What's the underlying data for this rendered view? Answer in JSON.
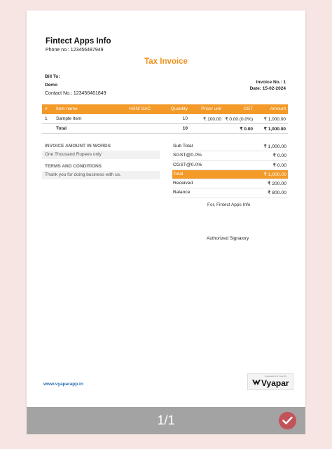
{
  "company": {
    "name": "Fintect Apps Info",
    "phone": "Phone no.: 123456487949"
  },
  "document": {
    "title": "Tax Invoice"
  },
  "bill_to": {
    "label": "Bill To:",
    "name": "Demo",
    "contact": "Contact No.: 123456461849"
  },
  "invoice_meta": {
    "number": "Invoice No.: 1",
    "date": "Date: 15-02-2024"
  },
  "items_table": {
    "headers": [
      "#",
      "Item name",
      "HSN/ SAC",
      "Quantity",
      "Price/ unit",
      "GST",
      "Amount"
    ],
    "rows": [
      {
        "no": "1",
        "name": "Sample Item",
        "hsn": "",
        "quantity": "10",
        "price": "₹ 100.00",
        "gst": "₹ 0.00 (0.0%)",
        "amount": "₹ 1,000.00"
      }
    ],
    "total": {
      "label": "Total",
      "quantity": "10",
      "gst": "₹ 0.00",
      "amount": "₹ 1,000.00"
    }
  },
  "amount_in_words": {
    "heading": "INVOICE AMOUNT IN WORDS",
    "value": "One Thousand Rupees only"
  },
  "terms": {
    "heading": "TERMS AND CONDITIONS",
    "value": "Thank you for doing business with us."
  },
  "summary": [
    {
      "label": "Sub Total",
      "value": "₹ 1,000.00"
    },
    {
      "label": "SGST@0.0%",
      "value": "₹ 0.00"
    },
    {
      "label": "CGST@0.0%",
      "value": "₹ 0.00"
    },
    {
      "label": "Total",
      "value": "₹ 1,000.00"
    },
    {
      "label": "Received",
      "value": "₹ 200.00"
    },
    {
      "label": "Balance",
      "value": "₹ 800.00"
    }
  ],
  "signature": {
    "for_company": "For, Fintect Apps Info",
    "label": "Authorized Signatory"
  },
  "footer": {
    "website": "www.vyaparapp.in",
    "badge_tag": "Generated For Free By",
    "badge_name": "Vyapar"
  },
  "viewer": {
    "page_indicator": "1/1",
    "done_icon": "check-icon"
  },
  "colors": {
    "accent": "#f39a28",
    "done_button": "#c45259",
    "link": "#2a6fb2"
  }
}
